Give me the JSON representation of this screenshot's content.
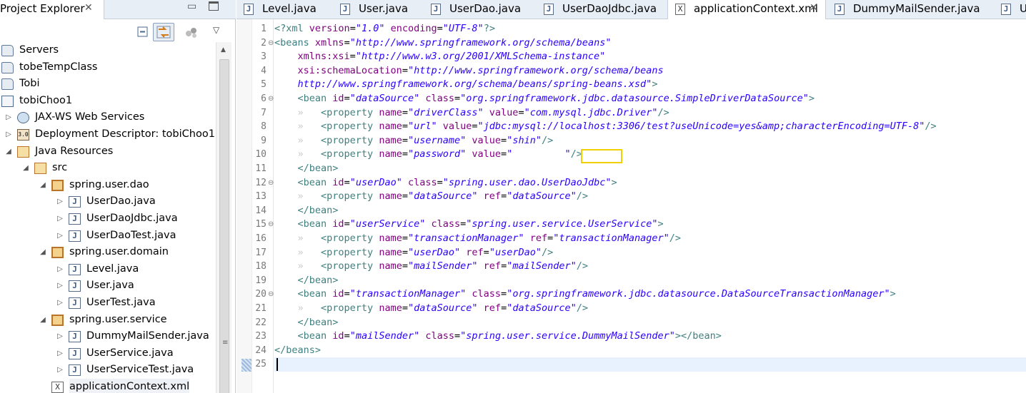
{
  "explorer": {
    "title": "Project Explorer",
    "close_glyph": "✕",
    "minimize_glyph": "▭",
    "toolbar": {
      "collapse_icon": "collapse-all-icon",
      "link_icon": "link-with-editor-icon",
      "focus_icon": "focus-icon",
      "menu_glyph": "▽"
    },
    "tree": [
      {
        "label": "Servers",
        "icon": "folder-icon",
        "toggle": "",
        "depth": 0
      },
      {
        "label": "tobeTempClass",
        "icon": "folder-icon",
        "toggle": "",
        "depth": 0
      },
      {
        "label": "Tobi",
        "icon": "folder-icon",
        "toggle": "",
        "depth": 0
      },
      {
        "label": "tobiChoo1",
        "icon": "project-icon",
        "toggle": "",
        "depth": 0
      },
      {
        "label": "JAX-WS Web Services",
        "icon": "web-services-icon",
        "toggle": "▷",
        "depth": 1
      },
      {
        "label": "Deployment Descriptor: tobiChoo1",
        "icon": "deployment-descriptor-icon",
        "toggle": "▷",
        "depth": 1
      },
      {
        "label": "Java Resources",
        "icon": "java-resources-icon",
        "toggle": "◢",
        "depth": 1
      },
      {
        "label": "src",
        "icon": "source-folder-icon",
        "toggle": "◢",
        "depth": 2
      },
      {
        "label": "spring.user.dao",
        "icon": "package-icon",
        "toggle": "◢",
        "depth": 3
      },
      {
        "label": "UserDao.java",
        "icon": "java-file-icon",
        "toggle": "▷",
        "depth": 4
      },
      {
        "label": "UserDaoJdbc.java",
        "icon": "java-file-icon",
        "toggle": "▷",
        "depth": 4
      },
      {
        "label": "UserDaoTest.java",
        "icon": "java-file-icon",
        "toggle": "▷",
        "depth": 4
      },
      {
        "label": "spring.user.domain",
        "icon": "package-icon",
        "toggle": "◢",
        "depth": 3
      },
      {
        "label": "Level.java",
        "icon": "java-file-icon",
        "toggle": "▷",
        "depth": 4
      },
      {
        "label": "User.java",
        "icon": "java-file-icon",
        "toggle": "▷",
        "depth": 4
      },
      {
        "label": "UserTest.java",
        "icon": "java-file-icon",
        "toggle": "▷",
        "depth": 4
      },
      {
        "label": "spring.user.service",
        "icon": "package-icon",
        "toggle": "◢",
        "depth": 3
      },
      {
        "label": "DummyMailSender.java",
        "icon": "java-file-icon",
        "toggle": "▷",
        "depth": 4
      },
      {
        "label": "UserService.java",
        "icon": "java-file-icon",
        "toggle": "▷",
        "depth": 4
      },
      {
        "label": "UserServiceTest.java",
        "icon": "java-file-icon-warning",
        "toggle": "▷",
        "depth": 4
      },
      {
        "label": "applicationContext.xml",
        "icon": "xml-file-icon",
        "toggle": "",
        "depth": 3
      }
    ]
  },
  "editor": {
    "tabs": [
      {
        "label": "Level.java",
        "icon": "java-file-icon",
        "active": false
      },
      {
        "label": "User.java",
        "icon": "java-file-icon",
        "active": false
      },
      {
        "label": "UserDao.java",
        "icon": "java-file-icon",
        "active": false
      },
      {
        "label": "UserDaoJdbc.java",
        "icon": "java-file-icon",
        "active": false
      },
      {
        "label": "applicationContext.xml",
        "icon": "xml-file-icon",
        "active": true
      },
      {
        "label": "DummyMailSender.java",
        "icon": "java-file-icon",
        "active": false
      },
      {
        "label": "U",
        "icon": "java-file-icon",
        "active": false
      }
    ],
    "current_line": 25,
    "fold_glyph": "⊖",
    "lines": [
      {
        "n": "1",
        "fold": "",
        "tokens": [
          [
            "t-tag",
            "<?xml"
          ],
          [
            "t-plain",
            " "
          ],
          [
            "t-attr",
            "version"
          ],
          [
            "t-plain",
            "="
          ],
          [
            "t-val",
            "\"1.0\""
          ],
          [
            "t-plain",
            " "
          ],
          [
            "t-attr",
            "encoding"
          ],
          [
            "t-plain",
            "="
          ],
          [
            "t-val",
            "\"UTF-8\""
          ],
          [
            "t-tag",
            "?>"
          ]
        ]
      },
      {
        "n": "2",
        "fold": "⊖",
        "tokens": [
          [
            "t-tag",
            "<beans"
          ],
          [
            "t-plain",
            " "
          ],
          [
            "t-attr",
            "xmlns"
          ],
          [
            "t-plain",
            "="
          ],
          [
            "t-val",
            "\"http://www.springframework.org/schema/beans\""
          ]
        ]
      },
      {
        "n": "3",
        "fold": "",
        "tokens": [
          [
            "t-plain",
            "    "
          ],
          [
            "t-attr",
            "xmlns:xsi"
          ],
          [
            "t-plain",
            "="
          ],
          [
            "t-val",
            "\"http://www.w3.org/2001/XMLSchema-instance\""
          ]
        ]
      },
      {
        "n": "4",
        "fold": "",
        "tokens": [
          [
            "t-plain",
            "    "
          ],
          [
            "t-attr",
            "xsi:schemaLocation"
          ],
          [
            "t-plain",
            "="
          ],
          [
            "t-val",
            "\"http://www.springframework.org/schema/beans"
          ]
        ]
      },
      {
        "n": "5",
        "fold": "",
        "tokens": [
          [
            "t-plain",
            "    "
          ],
          [
            "t-val",
            "http://www.springframework.org/schema/beans/spring-beans.xsd\""
          ],
          [
            "t-tag",
            ">"
          ]
        ]
      },
      {
        "n": "6",
        "fold": "⊖",
        "tokens": [
          [
            "t-plain",
            "    "
          ],
          [
            "t-tag",
            "<bean"
          ],
          [
            "t-plain",
            " "
          ],
          [
            "t-attr",
            "id"
          ],
          [
            "t-plain",
            "="
          ],
          [
            "t-val",
            "\"dataSource\""
          ],
          [
            "t-plain",
            " "
          ],
          [
            "t-attr",
            "class"
          ],
          [
            "t-plain",
            "="
          ],
          [
            "t-val",
            "\"org.springframework.jdbc.datasource.SimpleDriverDataSource\""
          ],
          [
            "t-tag",
            ">"
          ]
        ]
      },
      {
        "n": "7",
        "fold": "",
        "tokens": [
          [
            "t-dot",
            "    »   "
          ],
          [
            "t-tag",
            "<property"
          ],
          [
            "t-plain",
            " "
          ],
          [
            "t-attr",
            "name"
          ],
          [
            "t-plain",
            "="
          ],
          [
            "t-val",
            "\"driverClass\""
          ],
          [
            "t-plain",
            " "
          ],
          [
            "t-attr",
            "value"
          ],
          [
            "t-plain",
            "="
          ],
          [
            "t-val",
            "\"com.mysql.jdbc.Driver\""
          ],
          [
            "t-tag",
            "/>"
          ]
        ]
      },
      {
        "n": "8",
        "fold": "",
        "tokens": [
          [
            "t-dot",
            "    »   "
          ],
          [
            "t-tag",
            "<property"
          ],
          [
            "t-plain",
            " "
          ],
          [
            "t-attr",
            "name"
          ],
          [
            "t-plain",
            "="
          ],
          [
            "t-val",
            "\"url\""
          ],
          [
            "t-plain",
            " "
          ],
          [
            "t-attr",
            "value"
          ],
          [
            "t-plain",
            "="
          ],
          [
            "t-val",
            "\"jdbc:mysql://localhost:3306/test?useUnicode=yes&amp;characterEncoding=UTF-8\""
          ],
          [
            "t-tag",
            "/>"
          ]
        ]
      },
      {
        "n": "9",
        "fold": "",
        "tokens": [
          [
            "t-dot",
            "    »   "
          ],
          [
            "t-tag",
            "<property"
          ],
          [
            "t-plain",
            " "
          ],
          [
            "t-attr",
            "name"
          ],
          [
            "t-plain",
            "="
          ],
          [
            "t-val",
            "\"username\""
          ],
          [
            "t-plain",
            " "
          ],
          [
            "t-attr",
            "value"
          ],
          [
            "t-plain",
            "="
          ],
          [
            "t-val",
            "\"shin\""
          ],
          [
            "t-tag",
            "/>"
          ]
        ]
      },
      {
        "n": "10",
        "fold": "",
        "tokens": [
          [
            "t-dot",
            "    »   "
          ],
          [
            "t-tag",
            "<property"
          ],
          [
            "t-plain",
            " "
          ],
          [
            "t-attr",
            "name"
          ],
          [
            "t-plain",
            "="
          ],
          [
            "t-val",
            "\"password\""
          ],
          [
            "t-plain",
            " "
          ],
          [
            "t-attr",
            "value"
          ],
          [
            "t-plain",
            "="
          ],
          [
            "t-val",
            "\"         \""
          ],
          [
            "t-tag",
            "/>"
          ]
        ]
      },
      {
        "n": "11",
        "fold": "",
        "tokens": [
          [
            "t-dot",
            "    "
          ],
          [
            "t-tag",
            "</bean>"
          ]
        ]
      },
      {
        "n": "12",
        "fold": "⊖",
        "tokens": [
          [
            "t-plain",
            "    "
          ],
          [
            "t-tag",
            "<bean"
          ],
          [
            "t-plain",
            " "
          ],
          [
            "t-attr",
            "id"
          ],
          [
            "t-plain",
            "="
          ],
          [
            "t-val",
            "\"userDao\""
          ],
          [
            "t-plain",
            " "
          ],
          [
            "t-attr",
            "class"
          ],
          [
            "t-plain",
            "="
          ],
          [
            "t-val",
            "\"spring.user.dao.UserDaoJdbc\""
          ],
          [
            "t-tag",
            ">"
          ]
        ]
      },
      {
        "n": "13",
        "fold": "",
        "tokens": [
          [
            "t-dot",
            "    »   "
          ],
          [
            "t-tag",
            "<property"
          ],
          [
            "t-plain",
            " "
          ],
          [
            "t-attr",
            "name"
          ],
          [
            "t-plain",
            "="
          ],
          [
            "t-val",
            "\"dataSource\""
          ],
          [
            "t-plain",
            " "
          ],
          [
            "t-attr",
            "ref"
          ],
          [
            "t-plain",
            "="
          ],
          [
            "t-val",
            "\"dataSource\""
          ],
          [
            "t-tag",
            "/>"
          ]
        ]
      },
      {
        "n": "14",
        "fold": "",
        "tokens": [
          [
            "t-dot",
            "    "
          ],
          [
            "t-tag",
            "</bean>"
          ]
        ]
      },
      {
        "n": "15",
        "fold": "⊖",
        "tokens": [
          [
            "t-plain",
            "    "
          ],
          [
            "t-tag",
            "<bean"
          ],
          [
            "t-plain",
            " "
          ],
          [
            "t-attr",
            "id"
          ],
          [
            "t-plain",
            "="
          ],
          [
            "t-val",
            "\"userService\""
          ],
          [
            "t-plain",
            " "
          ],
          [
            "t-attr",
            "class"
          ],
          [
            "t-plain",
            "="
          ],
          [
            "t-val",
            "\"spring.user.service.UserService\""
          ],
          [
            "t-tag",
            ">"
          ]
        ]
      },
      {
        "n": "16",
        "fold": "",
        "tokens": [
          [
            "t-dot",
            "    »   "
          ],
          [
            "t-tag",
            "<property"
          ],
          [
            "t-plain",
            " "
          ],
          [
            "t-attr",
            "name"
          ],
          [
            "t-plain",
            "="
          ],
          [
            "t-val",
            "\"transactionManager\""
          ],
          [
            "t-plain",
            " "
          ],
          [
            "t-attr",
            "ref"
          ],
          [
            "t-plain",
            "="
          ],
          [
            "t-val",
            "\"transactionManager\""
          ],
          [
            "t-tag",
            "/>"
          ]
        ]
      },
      {
        "n": "17",
        "fold": "",
        "tokens": [
          [
            "t-dot",
            "    »   "
          ],
          [
            "t-tag",
            "<property"
          ],
          [
            "t-plain",
            " "
          ],
          [
            "t-attr",
            "name"
          ],
          [
            "t-plain",
            "="
          ],
          [
            "t-val",
            "\"userDao\""
          ],
          [
            "t-plain",
            " "
          ],
          [
            "t-attr",
            "ref"
          ],
          [
            "t-plain",
            "="
          ],
          [
            "t-val",
            "\"userDao\""
          ],
          [
            "t-tag",
            "/>"
          ]
        ]
      },
      {
        "n": "18",
        "fold": "",
        "tokens": [
          [
            "t-dot",
            "    »   "
          ],
          [
            "t-tag",
            "<property"
          ],
          [
            "t-plain",
            " "
          ],
          [
            "t-attr",
            "name"
          ],
          [
            "t-plain",
            "="
          ],
          [
            "t-val",
            "\"mailSender\""
          ],
          [
            "t-plain",
            " "
          ],
          [
            "t-attr",
            "ref"
          ],
          [
            "t-plain",
            "="
          ],
          [
            "t-val",
            "\"mailSender\""
          ],
          [
            "t-tag",
            "/>"
          ]
        ]
      },
      {
        "n": "19",
        "fold": "",
        "tokens": [
          [
            "t-dot",
            "    "
          ],
          [
            "t-tag",
            "</bean>"
          ]
        ]
      },
      {
        "n": "20",
        "fold": "⊖",
        "tokens": [
          [
            "t-plain",
            "    "
          ],
          [
            "t-tag",
            "<bean"
          ],
          [
            "t-plain",
            " "
          ],
          [
            "t-attr",
            "id"
          ],
          [
            "t-plain",
            "="
          ],
          [
            "t-val",
            "\"transactionManager\""
          ],
          [
            "t-plain",
            " "
          ],
          [
            "t-attr",
            "class"
          ],
          [
            "t-plain",
            "="
          ],
          [
            "t-val",
            "\"org.springframework.jdbc.datasource.DataSourceTransactionManager\""
          ],
          [
            "t-tag",
            ">"
          ]
        ]
      },
      {
        "n": "21",
        "fold": "",
        "tokens": [
          [
            "t-dot",
            "    »   "
          ],
          [
            "t-tag",
            "<property"
          ],
          [
            "t-plain",
            " "
          ],
          [
            "t-attr",
            "name"
          ],
          [
            "t-plain",
            "="
          ],
          [
            "t-val",
            "\"dataSource\""
          ],
          [
            "t-plain",
            " "
          ],
          [
            "t-attr",
            "ref"
          ],
          [
            "t-plain",
            "="
          ],
          [
            "t-val",
            "\"dataSource\""
          ],
          [
            "t-tag",
            "/>"
          ]
        ]
      },
      {
        "n": "22",
        "fold": "",
        "tokens": [
          [
            "t-dot",
            "    "
          ],
          [
            "t-tag",
            "</bean>"
          ]
        ]
      },
      {
        "n": "23",
        "fold": "",
        "tokens": [
          [
            "t-plain",
            "    "
          ],
          [
            "t-tag",
            "<bean"
          ],
          [
            "t-plain",
            " "
          ],
          [
            "t-attr",
            "id"
          ],
          [
            "t-plain",
            "="
          ],
          [
            "t-val",
            "\"mailSender\""
          ],
          [
            "t-plain",
            " "
          ],
          [
            "t-attr",
            "class"
          ],
          [
            "t-plain",
            "="
          ],
          [
            "t-val",
            "\"spring.user.service.DummyMailSender\""
          ],
          [
            "t-tag",
            "></bean>"
          ]
        ]
      },
      {
        "n": "24",
        "fold": "",
        "tokens": [
          [
            "t-tag",
            "</beans>"
          ]
        ]
      },
      {
        "n": "25",
        "fold": "",
        "tokens": []
      }
    ]
  }
}
